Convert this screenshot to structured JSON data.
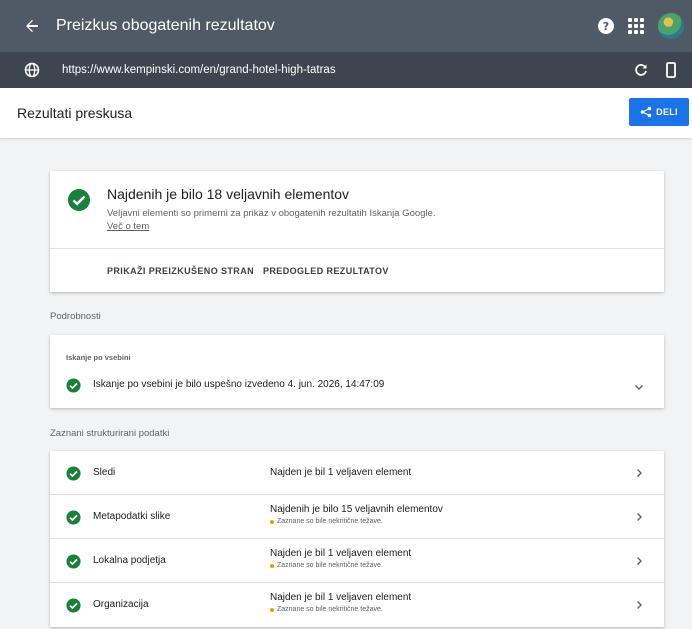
{
  "header": {
    "title": "Preizkus obogatenih rezultatov"
  },
  "urlbar": {
    "url": "https://www.kempinski.com/en/grand-hotel-high-tatras"
  },
  "titlebar": {
    "title": "Rezultati preskusa",
    "share_label": "DELI"
  },
  "summary": {
    "title": "Najdenih je bilo 18 veljavnih elementov",
    "description": "Veljavni elementi so primerni za prikaz v obogatenih rezultatih Iskanja Google.",
    "link": "Več o tem",
    "action_view": "PRIKAŽI PREIZKUŠENO STRAN",
    "action_preview": "PREDOGLED REZULTATOV"
  },
  "details": {
    "label": "Podrobnosti",
    "crawl_label": "Iskanje po vsebini",
    "crawl_message": "Iskanje po vsebini je bilo uspešno izvedeno 4. jun. 2026, 14:47:09"
  },
  "structured": {
    "label": "Zaznani strukturirani podatki",
    "items": [
      {
        "name": "Sledi",
        "status": "Najden je bil 1 veljaven element",
        "warning": ""
      },
      {
        "name": "Metapodatki slike",
        "status": "Najdenih je bilo 15 veljavnih elementov",
        "warning": "Zaznane so bile nekritične težave."
      },
      {
        "name": "Lokalna podjetja",
        "status": "Najden je bil 1 veljaven element",
        "warning": "Zaznane so bile nekritične težave."
      },
      {
        "name": "Organizacija",
        "status": "Najden je bil 1 veljaven element",
        "warning": "Zaznane so bile nekritične težave."
      }
    ]
  },
  "colors": {
    "header": "#505a66",
    "urlbar": "#3c4550",
    "accent": "#1a73e8",
    "success": "#188038",
    "warning": "#f29900"
  }
}
